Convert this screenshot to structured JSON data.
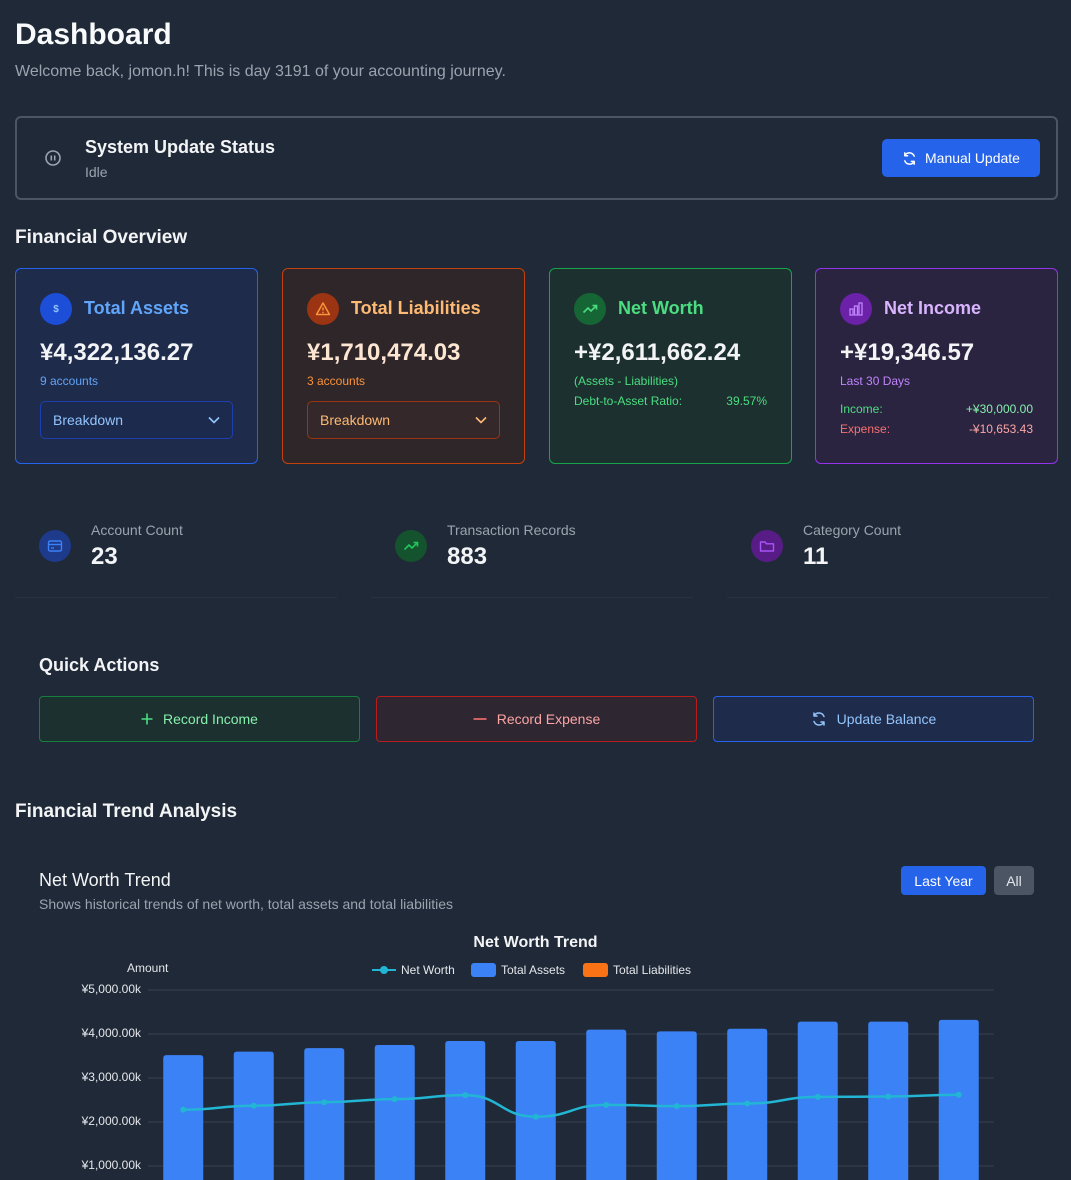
{
  "header": {
    "title": "Dashboard",
    "welcome": "Welcome back, jomon.h! This is day 3191 of your accounting journey."
  },
  "system_status": {
    "title": "System Update Status",
    "value": "Idle",
    "button_label": "Manual Update",
    "icons": {
      "status": "pause-circle-icon",
      "button": "refresh-icon"
    }
  },
  "overview": {
    "title": "Financial Overview",
    "cards": {
      "assets": {
        "title": "Total Assets",
        "value": "¥4,322,136.27",
        "sub": "9 accounts",
        "dropdown": "Breakdown",
        "color": "#60a5fa",
        "icon": "dollar-icon"
      },
      "liabilities": {
        "title": "Total Liabilities",
        "value": "¥1,710,474.03",
        "sub": "3 accounts",
        "dropdown": "Breakdown",
        "color": "#fb923c",
        "icon": "warning-icon"
      },
      "net_worth": {
        "title": "Net Worth",
        "value": "+¥2,611,662.24",
        "sub": "(Assets - Liabilities)",
        "ratio_label": "Debt-to-Asset Ratio:",
        "ratio_value": "39.57%",
        "color": "#4ade80",
        "icon": "trending-up-icon"
      },
      "net_income": {
        "title": "Net Income",
        "value": "+¥19,346.57",
        "sub": "Last 30 Days",
        "income_label": "Income:",
        "income_value": "+¥30,000.00",
        "expense_label": "Expense:",
        "expense_value": "-¥10,653.43",
        "color": "#c084fc",
        "icon": "bar-chart-icon"
      }
    }
  },
  "stats": [
    {
      "label": "Account Count",
      "value": "23",
      "icon": "credit-card-icon"
    },
    {
      "label": "Transaction Records",
      "value": "883",
      "icon": "trending-up-icon"
    },
    {
      "label": "Category Count",
      "value": "11",
      "icon": "folder-icon"
    }
  ],
  "quick_actions": {
    "title": "Quick Actions",
    "record_income": "Record Income",
    "record_expense": "Record Expense",
    "update_balance": "Update Balance"
  },
  "trend": {
    "section_title": "Financial Trend Analysis",
    "card_title": "Net Worth Trend",
    "card_desc": "Shows historical trends of net worth, total assets and total liabilities",
    "range_last_year": "Last Year",
    "range_all": "All"
  },
  "chart_data": {
    "type": "bar",
    "title": "Net Worth Trend",
    "ylabel": "Amount",
    "ylim": [
      0,
      5000000
    ],
    "yticks": [
      "¥1,000.00k",
      "¥2,000.00k",
      "¥3,000.00k",
      "¥4,000.00k",
      "¥5,000.00k"
    ],
    "legend": [
      "Net Worth",
      "Total Assets",
      "Total Liabilities"
    ],
    "legend_position": "top-center",
    "grid": true,
    "series": [
      {
        "name": "Total Assets",
        "type": "bar",
        "color": "#3b82f6",
        "values": [
          3520000,
          3600000,
          3680000,
          3750000,
          3840000,
          3840000,
          4100000,
          4060000,
          4120000,
          4280000,
          4280000,
          4320000
        ]
      },
      {
        "name": "Net Worth",
        "type": "line",
        "color": "#22b5d4",
        "values": [
          2280000,
          2370000,
          2450000,
          2520000,
          2610000,
          2120000,
          2390000,
          2360000,
          2420000,
          2570000,
          2580000,
          2620000
        ]
      },
      {
        "name": "Total Liabilities",
        "type": "bar",
        "color": "#f97316",
        "values": []
      }
    ]
  }
}
